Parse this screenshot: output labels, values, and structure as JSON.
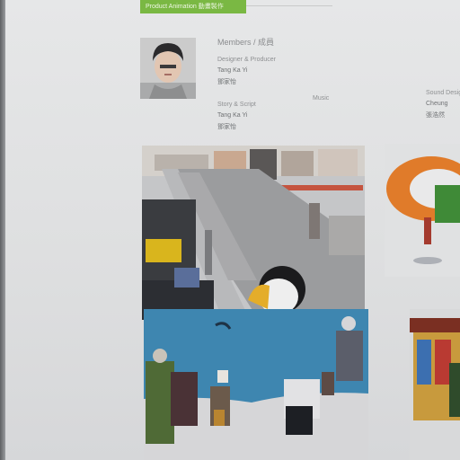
{
  "tag": {
    "label": "Product Animation 動畫製作"
  },
  "team": {
    "section_title": "Members / 成員",
    "members": [
      {
        "role": "Designer & Producer",
        "name": "Tang Ka Yi",
        "name_zh": "鄧家怡"
      },
      {
        "role": "Story & Script",
        "name": "Tang Ka Yi",
        "name_zh": "鄧家怡"
      },
      {
        "role": "Music",
        "name": "",
        "name_zh": ""
      },
      {
        "role": "Sound Design",
        "name": "Cheung",
        "name_zh": "張浩然"
      }
    ]
  },
  "icons": {
    "avatar": "portrait-photo",
    "thumbnails": "animation-still"
  },
  "colors": {
    "tag_bg": "#7ab843",
    "text": "#8e9092",
    "page_bg": "#e3e4e5"
  }
}
